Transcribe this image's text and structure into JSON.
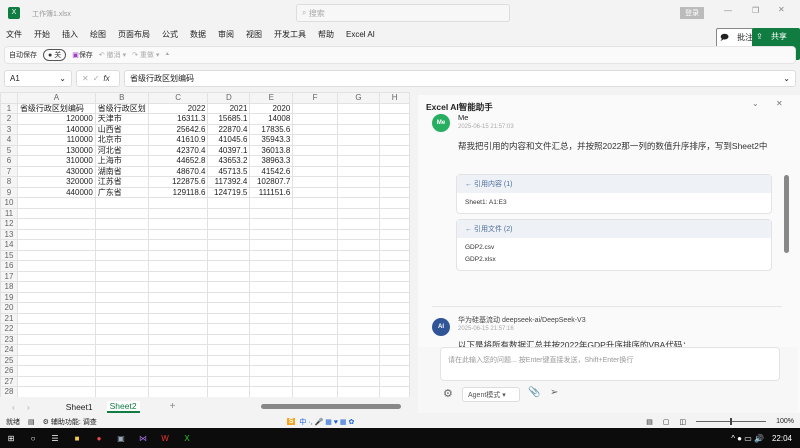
{
  "title": {
    "file": "工作簿1.xlsx",
    "search_placeholder": "搜索",
    "login": "登录"
  },
  "menu": [
    "文件",
    "开始",
    "插入",
    "绘图",
    "页面布局",
    "公式",
    "数据",
    "审阅",
    "视图",
    "开发工具",
    "帮助",
    "Excel AI"
  ],
  "actions": {
    "comment": "批注",
    "share": "共享"
  },
  "qat": {
    "autosave": "自动保存",
    "toggle": "关",
    "save": "保存",
    "undo": "撤消",
    "redo": "重做"
  },
  "formula": {
    "cell": "A1",
    "fx": "fx",
    "value": "省级行政区划编码"
  },
  "columns": [
    "A",
    "B",
    "C",
    "D",
    "E",
    "F",
    "G",
    "H"
  ],
  "rows": [
    [
      "省级行政区划编码",
      "省级行政区划",
      "2022",
      "2021",
      "2020"
    ],
    [
      "120000",
      "天津市",
      "16311.3",
      "15685.1",
      "14008"
    ],
    [
      "140000",
      "山西省",
      "25642.6",
      "22870.4",
      "17835.6"
    ],
    [
      "110000",
      "北京市",
      "41610.9",
      "41045.6",
      "35943.3"
    ],
    [
      "130000",
      "河北省",
      "42370.4",
      "40397.1",
      "36013.8"
    ],
    [
      "310000",
      "上海市",
      "44652.8",
      "43653.2",
      "38963.3"
    ],
    [
      "430000",
      "湖南省",
      "48670.4",
      "45713.5",
      "41542.6"
    ],
    [
      "320000",
      "江苏省",
      "122875.6",
      "117392.4",
      "102807.7"
    ],
    [
      "440000",
      "广东省",
      "129118.6",
      "124719.5",
      "111151.6"
    ]
  ],
  "sheets": [
    "Sheet1",
    "Sheet2"
  ],
  "active_sheet": "Sheet2",
  "pane": {
    "title": "Excel AI智能助手",
    "user": {
      "avatar": "Me",
      "name": "Me",
      "time": "2025-06-15 21:57:03",
      "message": "帮我把引用的内容和文件汇总，并按照2022那一列的数值升序排序，写到Sheet2中",
      "ref_content": {
        "header": "← 引用内容 (1)",
        "items": [
          "Sheet1: A1:E3"
        ]
      },
      "ref_files": {
        "header": "← 引用文件 (2)",
        "items": [
          "GDP2.csv",
          "GDP2.xlsx"
        ]
      }
    },
    "ai": {
      "avatar": "AI",
      "name": "华为硅基流动 deepseek-ai/DeepSeek-V3",
      "time": "2025-06-15 21:57:16",
      "message": "以下是将所有数据汇总并按2022年GDP升序排序的VBA代码："
    },
    "input_placeholder": "请在此输入您的问题... 按Enter键直接发送，Shift+Enter换行",
    "mode": "Agent模式"
  },
  "status": {
    "ready": "就绪",
    "accessibility": "辅助功能: 调查",
    "zoom": "100%"
  },
  "taskbar": {
    "time": "22:04"
  },
  "colors": {
    "excel_green": "#107c41",
    "me_avatar": "#27ae60",
    "ai_avatar": "#2f5597"
  }
}
